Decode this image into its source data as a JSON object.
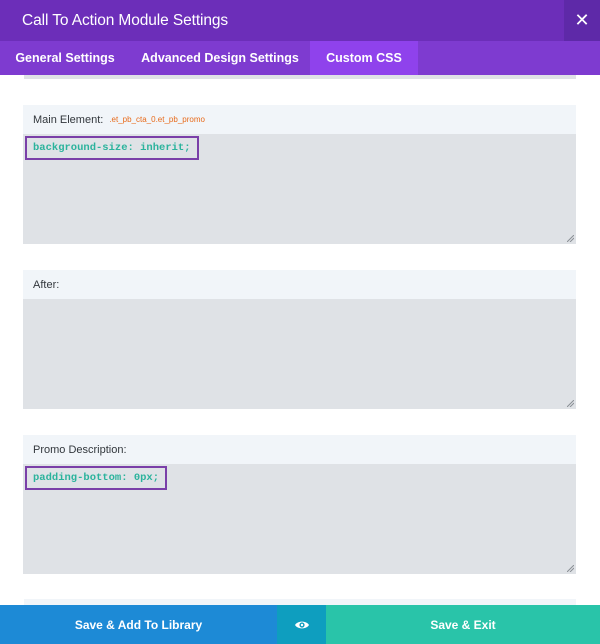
{
  "header": {
    "title": "Call To Action Module Settings",
    "close_icon": "close-icon"
  },
  "tabs": [
    {
      "label": "General Settings",
      "active": false
    },
    {
      "label": "Advanced Design Settings",
      "active": false
    },
    {
      "label": "Custom CSS",
      "active": true
    }
  ],
  "fields": [
    {
      "label": "Main Element:",
      "selector": ".et_pb_cta_0.et_pb_promo",
      "value": "background-size: inherit;"
    },
    {
      "label": "After:",
      "selector": "",
      "value": ""
    },
    {
      "label": "Promo Description:",
      "selector": "",
      "value": "padding-bottom: 0px;"
    }
  ],
  "footer": {
    "library_label": "Save & Add To Library",
    "preview_icon": "eye-icon",
    "exit_label": "Save & Exit"
  },
  "colors": {
    "header": "#6c2eb9",
    "tabs": "#7e3bd0",
    "active_tab": "#8f42ec",
    "code_text": "#2bb39c",
    "highlight_border": "#7a3fa8",
    "library_button": "#1d8ad6",
    "preview_button": "#0e9ebf",
    "exit_button": "#29c4a9"
  }
}
